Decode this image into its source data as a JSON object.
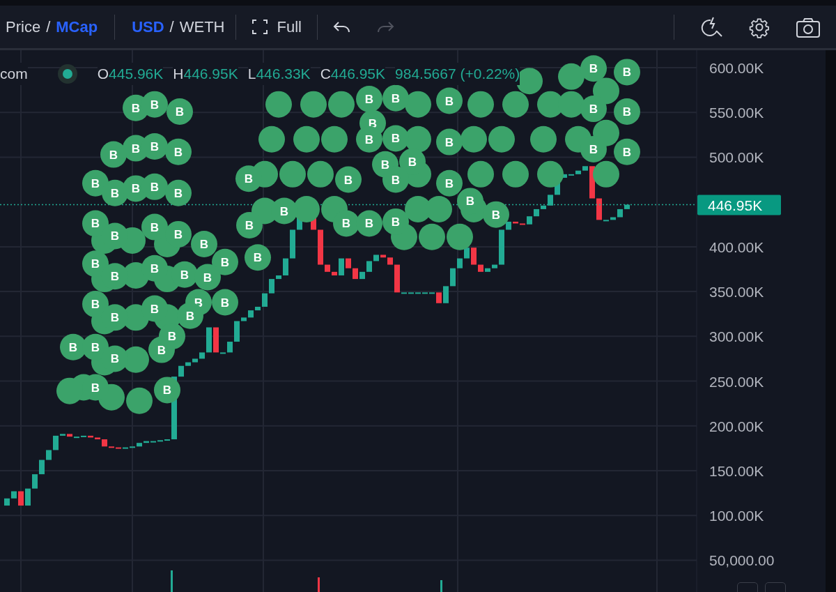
{
  "toolbar": {
    "price_mode": [
      {
        "label": "Price",
        "selected": false
      },
      {
        "label": "MCap",
        "selected": true
      }
    ],
    "price_mode_separator": "/",
    "currency": [
      {
        "label": "USD",
        "selected": true
      },
      {
        "label": "WETH",
        "selected": false
      }
    ],
    "currency_separator": "/",
    "full_label": "Full",
    "undo": {
      "disabled": false
    },
    "redo": {
      "disabled": true
    }
  },
  "legend": {
    "symbol": "com",
    "fields": [
      {
        "label": "O",
        "value": "445.96K"
      },
      {
        "label": "H",
        "value": "446.95K"
      },
      {
        "label": "L",
        "value": "446.33K"
      },
      {
        "label": "C",
        "value": "446.95K"
      }
    ],
    "change": "984.5667 (+0.22%)"
  },
  "chart": {
    "price_axis_labels": [
      "600.00K",
      "550.00K",
      "500.00K",
      "400.00K",
      "350.00K",
      "300.00K",
      "250.00K",
      "200.00K",
      "150.00K",
      "100.00K",
      "50,000.00"
    ],
    "last_price": "446.95K",
    "buy_markers": [
      "B",
      "B",
      "B",
      "B",
      "B",
      "B",
      "B",
      "B",
      "B",
      "B",
      "B",
      "B",
      "B",
      "B",
      "B",
      "B",
      "B",
      "B",
      "B",
      "B",
      "B",
      "B",
      "B",
      "B",
      "B",
      "B",
      "B",
      "B",
      "B",
      "B",
      "B",
      "B",
      "B",
      "B",
      "B",
      "B",
      "B",
      "B",
      "B",
      "B",
      "B",
      "B",
      "B",
      "B",
      "B",
      "B",
      "B",
      "B",
      "B",
      "B",
      "B",
      "B",
      "B",
      "B",
      "B",
      "B",
      "B",
      "B",
      "B",
      "B",
      "B",
      "B",
      "B"
    ]
  }
}
